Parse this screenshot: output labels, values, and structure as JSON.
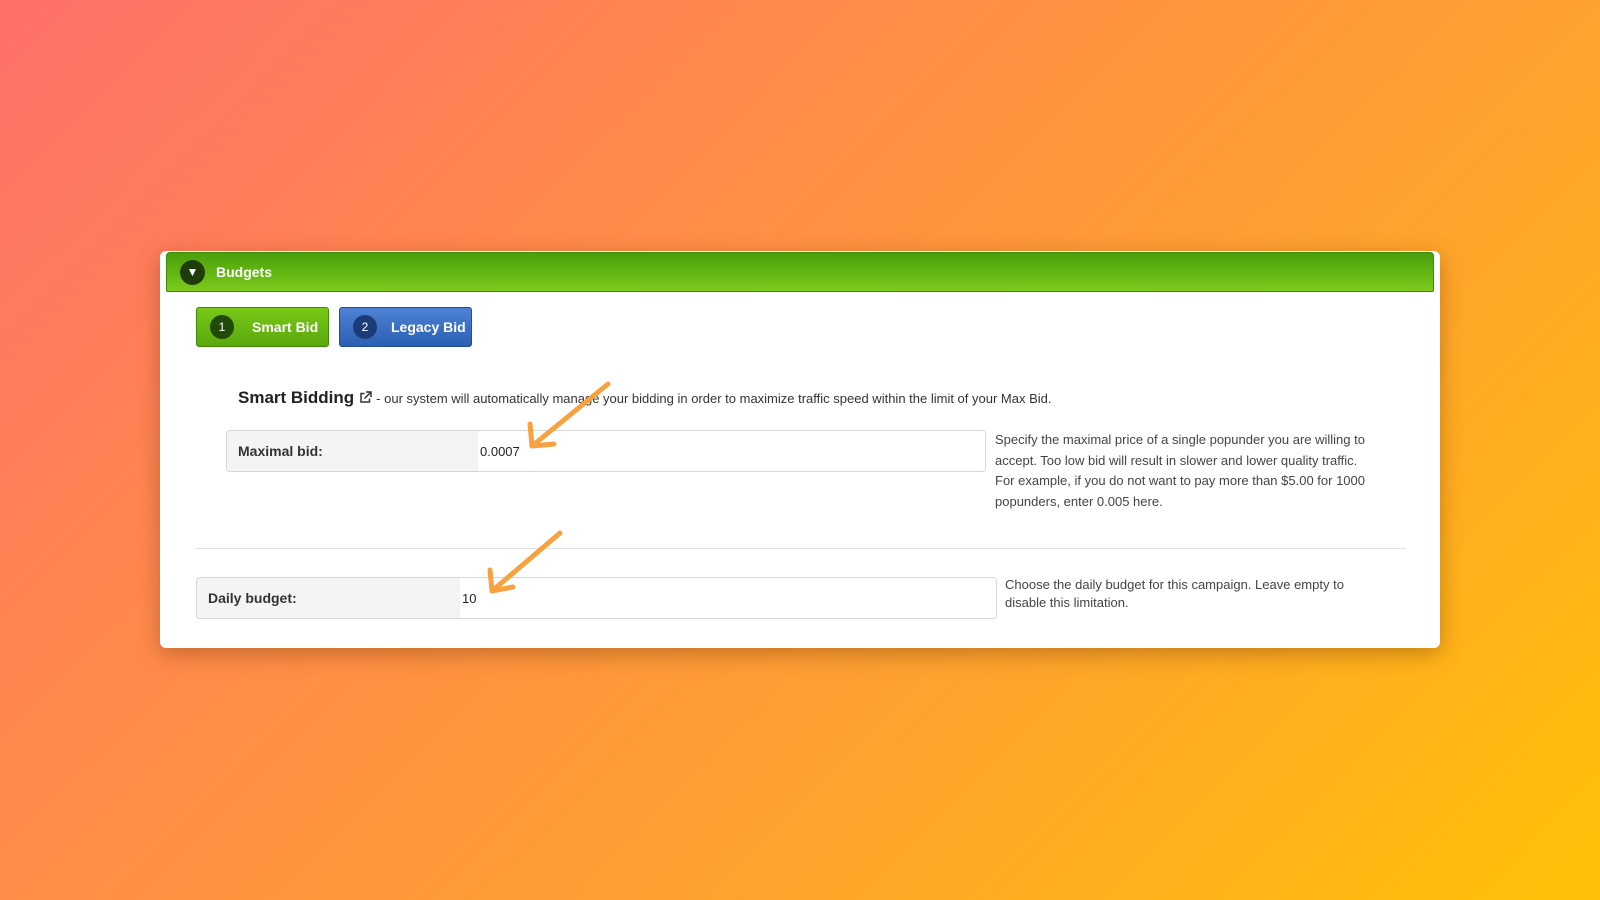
{
  "section": {
    "title": "Budgets",
    "toggle_icon": "caret-down-icon"
  },
  "tabs": [
    {
      "number": "1",
      "label": "Smart Bid",
      "color": "#5fb411",
      "active": true
    },
    {
      "number": "2",
      "label": "Legacy Bid",
      "color": "#2f64b8",
      "active": false
    }
  ],
  "intro": {
    "title": "Smart Bidding",
    "link_icon": "external-link-icon",
    "text": " - our system will automatically manage your bidding in order to maximize traffic speed within the limit of your Max Bid."
  },
  "max_bid": {
    "label": "Maximal bid:",
    "value": "0.0007",
    "help": "Specify the maximal price of a single popunder you are willing to accept. Too low bid will result in slower and lower quality traffic. For example, if you do not want to pay more than $5.00 for 1000 popunders, enter 0.005 here."
  },
  "daily_budget": {
    "label": "Daily budget:",
    "value": "10",
    "help": "Choose the daily budget for this campaign. Leave empty to disable this limitation."
  },
  "colors": {
    "header_green": "#5fb411",
    "legacy_blue": "#2f64b8",
    "annotation_arrow": "#f7a23f"
  }
}
